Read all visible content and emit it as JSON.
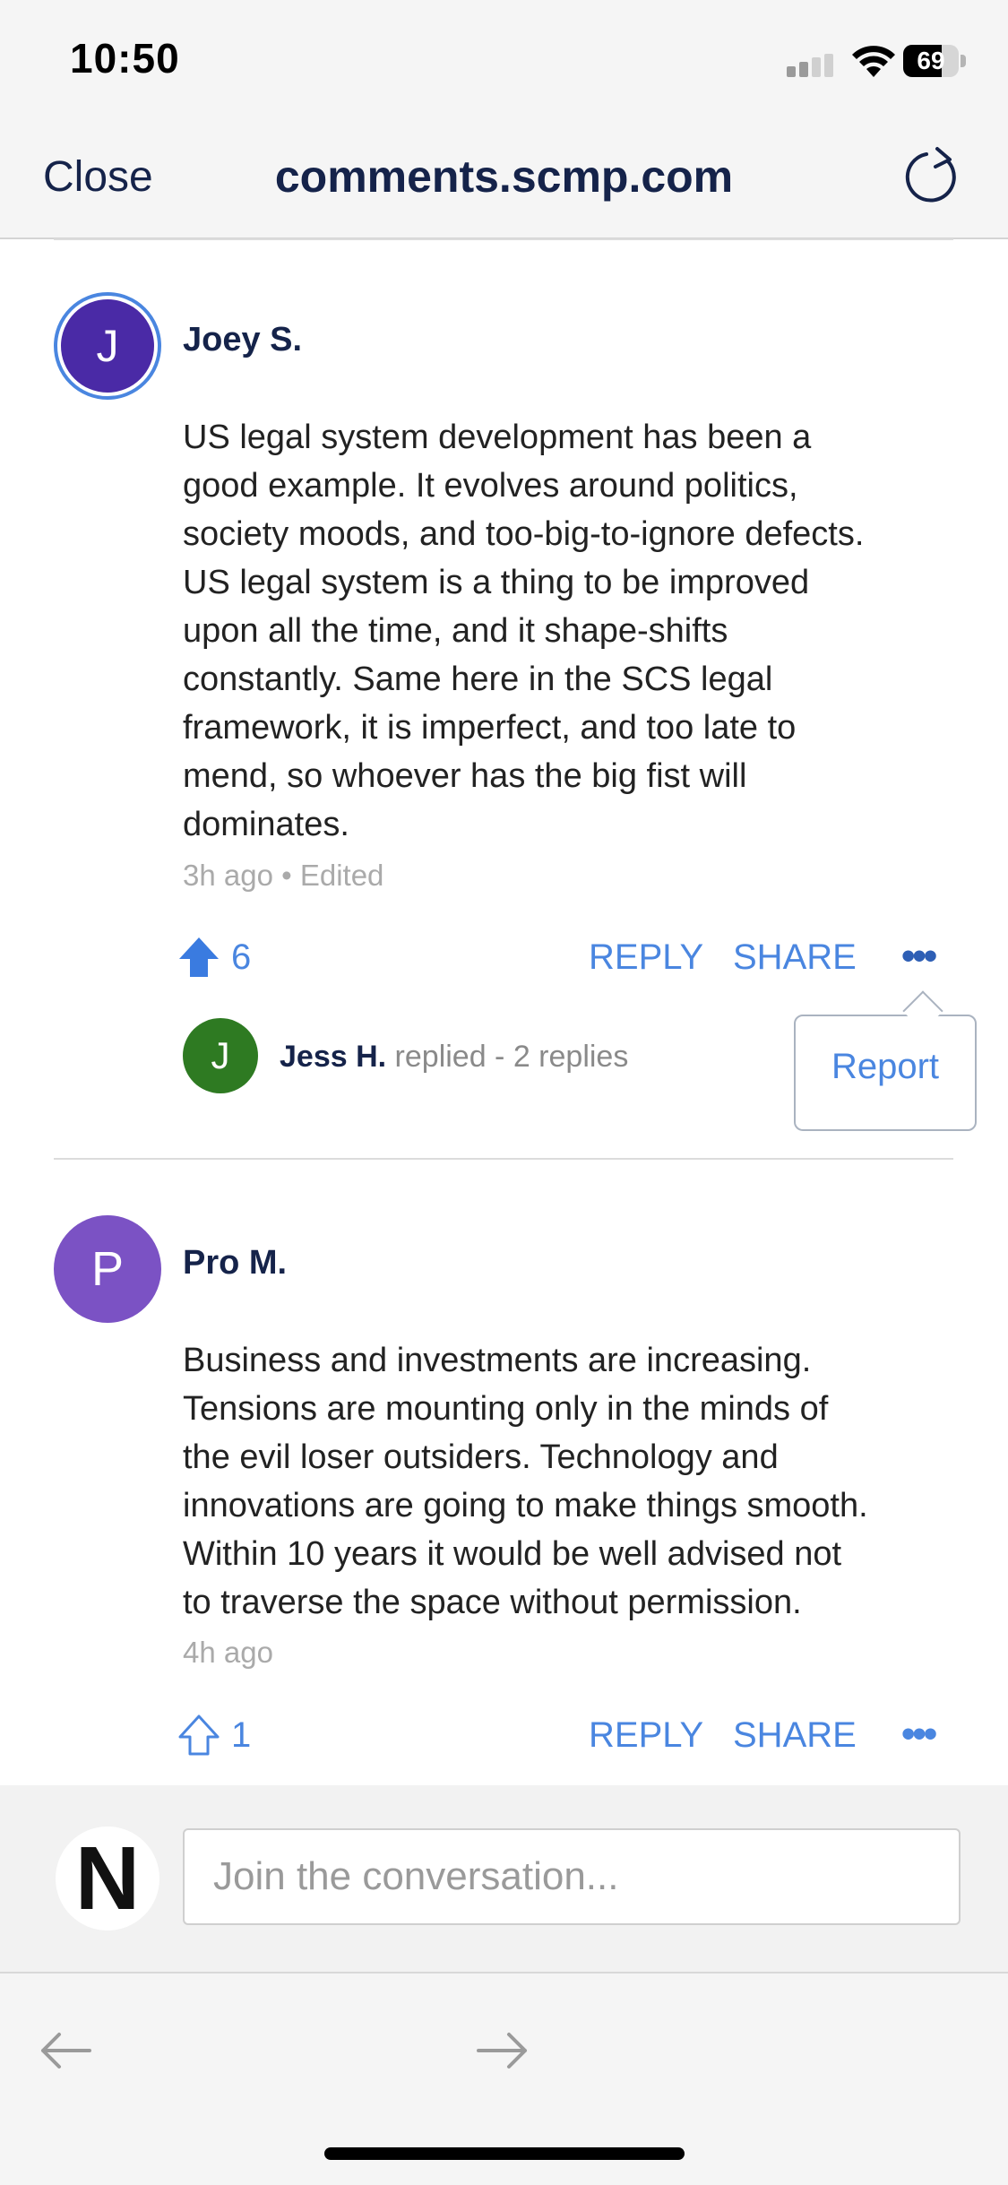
{
  "status_bar": {
    "time": "10:50",
    "battery": "69",
    "battery_level_pct": 69
  },
  "nav": {
    "close_label": "Close",
    "title": "comments.scmp.com",
    "reload_icon": "reload-icon"
  },
  "comments": [
    {
      "avatar_letter": "J",
      "avatar_color": "#4a2aa6",
      "author": "Joey S.",
      "body": "US legal system development has been a\ngood example.  It evolves around politics,\nsociety moods, and too-big-to-ignore defects.\n US legal system is a thing to be improved\nupon all the time, and it shape-shifts\nconstantly.  Same here in the SCS legal\nframework, it is imperfect, and too late to\nmend, so whoever has the big fist will\ndominates.",
      "meta": "3h ago • Edited",
      "upvotes": "6",
      "reply_label": "REPLY",
      "share_label": "SHARE",
      "more_label": "•••",
      "replies": {
        "avatar_letter": "J",
        "avatar_color": "#2e7a22",
        "author": "Jess H.",
        "text": "replied - 2 replies"
      },
      "menu": {
        "report_label": "Report"
      }
    },
    {
      "avatar_letter": "P",
      "avatar_color": "#7b52c4",
      "author": "Pro M.",
      "body": "Business and investments are increasing.\n Tensions are mounting only in the minds of\nthe evil loser outsiders.  Technology and\ninnovations are going to make things smooth.\n Within 10 years it would be well advised not\nto traverse the space without permission.",
      "meta": "4h ago",
      "upvotes": "1",
      "reply_label": "REPLY",
      "share_label": "SHARE",
      "more_label": "•••"
    }
  ],
  "composer": {
    "placeholder": "Join the conversation...",
    "logo_letter": "N"
  },
  "colors": {
    "accent": "#4a86e0",
    "navy": "#15234a",
    "upvote_active": "#3a7be0"
  }
}
